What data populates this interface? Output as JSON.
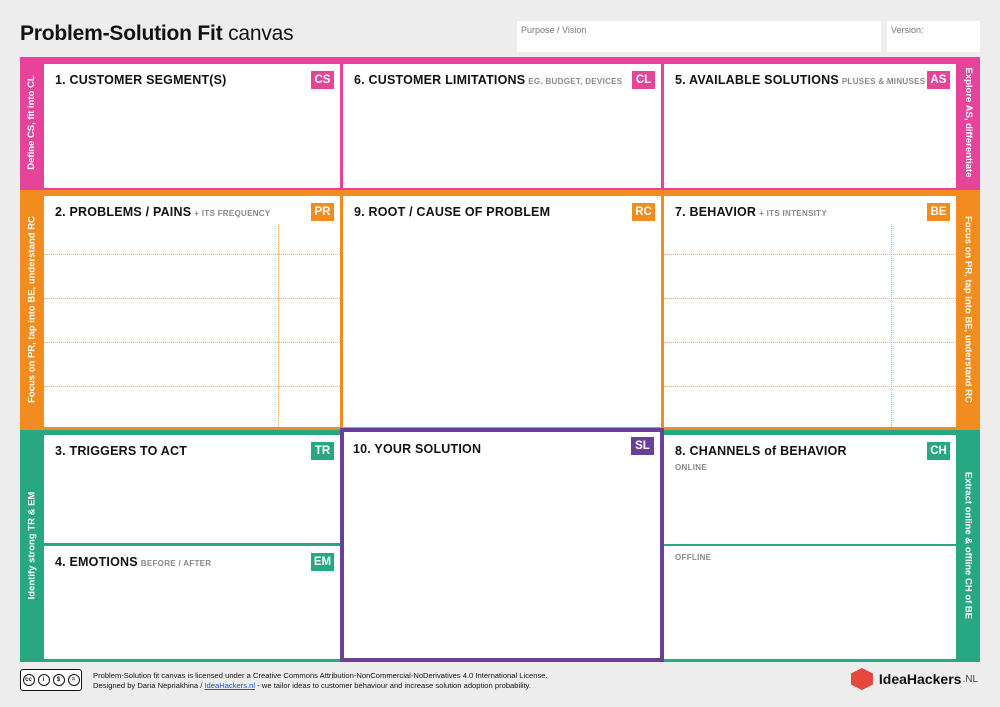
{
  "header": {
    "title_bold": "Problem-Solution Fit",
    "title_light": "canvas",
    "purpose_label": "Purpose / Vision",
    "version_label": "Version:"
  },
  "colors": {
    "pink": "#e6439a",
    "orange": "#f28c1e",
    "green": "#27a882",
    "purple": "#6a3f98"
  },
  "sides": {
    "pink_left": "Define CS, fit into CL",
    "pink_right": "Explore AS, differentiate",
    "orange_left": "Focus on PR, tap into BE, understand RC",
    "orange_right": "Focus on PR, tap into BE, understand RC",
    "green_left": "Identify strong TR & EM",
    "green_right": "Extract online & offline CH of BE"
  },
  "cells": {
    "cs": {
      "title": "1. CUSTOMER SEGMENT(S)",
      "sub": "",
      "badge": "CS"
    },
    "cl": {
      "title": "6. CUSTOMER LIMITATIONS",
      "sub": "EG. BUDGET, DEVICES",
      "badge": "CL"
    },
    "as": {
      "title": "5. AVAILABLE SOLUTIONS",
      "sub": "PLUSES & MINUSES",
      "badge": "AS"
    },
    "pr": {
      "title": "2. PROBLEMS / PAINS",
      "sub": "+ ITS FREQUENCY",
      "badge": "PR"
    },
    "rc": {
      "title": "9. ROOT / CAUSE OF PROBLEM",
      "sub": "",
      "badge": "RC"
    },
    "be": {
      "title": "7. BEHAVIOR",
      "sub": "+ ITS INTENSITY",
      "badge": "BE"
    },
    "tr": {
      "title": "3. TRIGGERS TO ACT",
      "sub": "",
      "badge": "TR"
    },
    "em": {
      "title": "4. EMOTIONS",
      "sub": "BEFORE / AFTER",
      "badge": "EM"
    },
    "sl": {
      "title": "10. YOUR SOLUTION",
      "sub": "",
      "badge": "SL"
    },
    "ch": {
      "title": "8. CHANNELS of BEHAVIOR",
      "sub": "",
      "badge": "CH",
      "online": "ONLINE",
      "offline": "OFFLINE"
    }
  },
  "footer": {
    "line1": "Problem-Solution fit canvas is licensed under a Creative Commons Attribution-NonCommercial-NoDerivatives 4.0 International License.",
    "line2_pre": "Designed by Daria Nepriakhina / ",
    "line2_link": "IdeaHackers.nl",
    "line2_post": " - we tailor ideas to customer behaviour and increase solution adoption probability.",
    "license_icons": [
      "cc",
      "by",
      "nc",
      "nd"
    ],
    "license_caption": "BY  NC  ND",
    "brand": "IdeaHackers",
    "brand_suffix": ".NL"
  }
}
